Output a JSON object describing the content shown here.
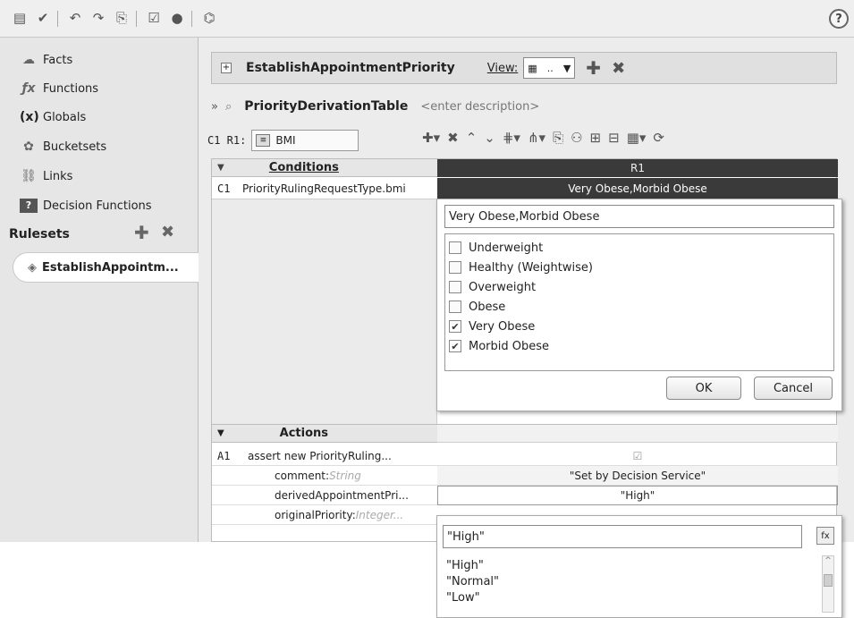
{
  "toolbar": {
    "icons": [
      "book-icon",
      "check-icon",
      "undo-icon",
      "redo-icon",
      "export-icon",
      "validate-icon",
      "error-icon",
      "test-icon",
      "help-icon"
    ],
    "help_label": "?"
  },
  "sidebar": {
    "items": [
      {
        "label": "Facts",
        "icon": "facts-icon",
        "glyph": "☁"
      },
      {
        "label": "Functions",
        "icon": "function-icon",
        "glyph": "ƒx"
      },
      {
        "label": "Globals",
        "icon": "globals-icon",
        "glyph": "(x)"
      },
      {
        "label": "Bucketsets",
        "icon": "bucketsets-icon",
        "glyph": "✿"
      },
      {
        "label": "Links",
        "icon": "links-icon",
        "glyph": "⛓"
      },
      {
        "label": "Decision Functions",
        "icon": "decision-functions-icon",
        "glyph": "?"
      }
    ],
    "rulesets_label": "Rulesets",
    "ruleset_item": "EstablishAppointm..."
  },
  "main": {
    "header_title": "EstablishAppointmentPriority",
    "view_label": "View:",
    "view_value": "..",
    "table_name": "PriorityDerivationTable",
    "table_desc": "<enter description>",
    "cell_ref": "C1 R1:",
    "cell_field": "BMI",
    "conditions_header": "Conditions",
    "r1_header": "R1",
    "condition_id": "C1",
    "condition_expr": "PriorityRulingRequestType.bmi",
    "condition_value": "Very Obese,Morbid Obese"
  },
  "popup": {
    "input_value": "Very Obese,Morbid Obese",
    "options": [
      {
        "label": "Underweight",
        "checked": false
      },
      {
        "label": "Healthy (Weightwise)",
        "checked": false
      },
      {
        "label": "Overweight",
        "checked": false
      },
      {
        "label": "Obese",
        "checked": false
      },
      {
        "label": "Very Obese",
        "checked": true
      },
      {
        "label": "Morbid Obese",
        "checked": true
      }
    ],
    "ok_label": "OK",
    "cancel_label": "Cancel"
  },
  "actions": {
    "header": "Actions",
    "action_id": "A1",
    "action_expr": "assert new PriorityRuling...",
    "rows": [
      {
        "name": "comment:",
        "type": "String",
        "value": "\"Set by Decision Service\""
      },
      {
        "name": "derivedAppointmentPri...",
        "type": "",
        "value": "\"High\""
      },
      {
        "name": "originalPriority:",
        "type": "Integer...",
        "value": ""
      }
    ]
  },
  "dropdown": {
    "input_value": "\"High\"",
    "options": [
      "\"High\"",
      "\"Normal\"",
      "\"Low\""
    ]
  }
}
